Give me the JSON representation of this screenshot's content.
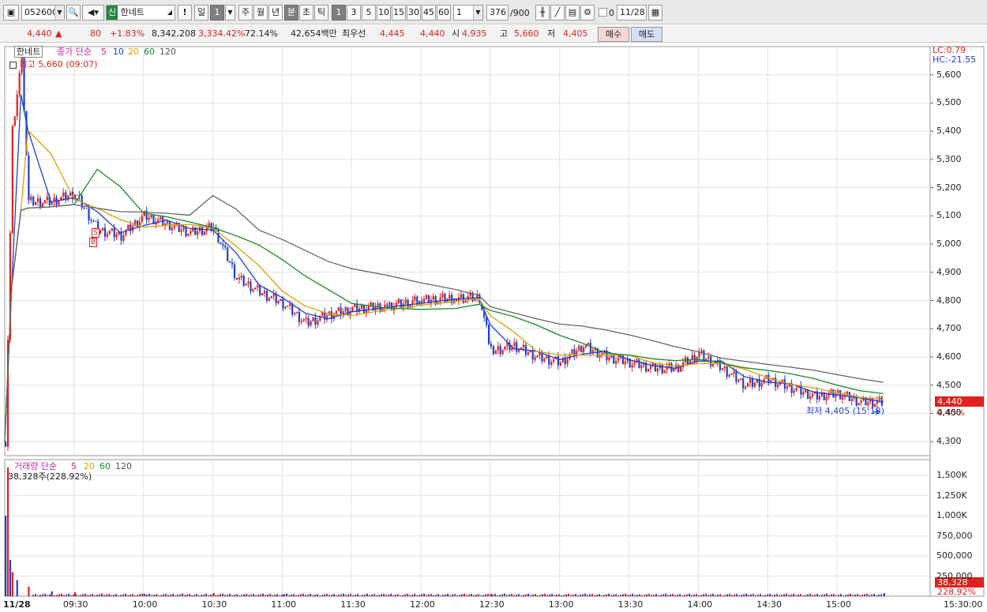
{
  "toolbar": {
    "code": "052600",
    "credit_badge": "신",
    "stock_name": "한네트",
    "alert_label": "!",
    "period_day": "일",
    "period_num": "1",
    "period_week": "주",
    "period_month": "월",
    "period_year": "년",
    "period_minute": "분",
    "period_second": "초",
    "period_tick": "틱",
    "intervals": [
      "1",
      "3",
      "5",
      "10",
      "15",
      "30",
      "45",
      "60"
    ],
    "interval_value": "1",
    "count_value": "376",
    "count_total": "/900",
    "checkbox_label": "0",
    "date_value": "11/28"
  },
  "quote": {
    "price": "4,440",
    "change_arrow": "▲",
    "change": "80",
    "change_pct": "+1.83%",
    "volume": "8,342,208",
    "volume_ratio": "3,334.42%",
    "turnover_ratio": "72.14%",
    "amount": "42,654백만",
    "best_label": "최우선",
    "best_ask": "4,445",
    "best_bid": "4,440",
    "open_label": "시",
    "open": "4,935",
    "high_label": "고",
    "high": "5,660",
    "low_label": "저",
    "low": "4,405",
    "buy_label": "매수",
    "sell_label": "매도"
  },
  "price_panel": {
    "name_tag": "한네트",
    "legend_label": "종가 단순",
    "ma": [
      "5",
      "10",
      "20",
      "60",
      "120"
    ],
    "high_marker": "최고 5,660 (09:07)",
    "low_marker": "최저 4,405 (15:18)",
    "lc": "LC:0.79",
    "hc": "HC:-21.55",
    "current_price": "4,440",
    "current_pct": "0.45%",
    "signal_s": "S",
    "signal_b": "B"
  },
  "volume_panel": {
    "legend_label": "거래량 단순",
    "ma": [
      "5",
      "20",
      "60",
      "120"
    ],
    "info": "38,328주(228.92%)",
    "current_volume": "38,328",
    "current_pct": "228.92%"
  },
  "chart_data": [
    {
      "type": "candlestick",
      "title": "한네트",
      "y_ticks": [
        "5,600",
        "5,500",
        "5,400",
        "5,300",
        "5,200",
        "5,100",
        "5,000",
        "4,900",
        "4,800",
        "4,700",
        "4,600",
        "4,500",
        "4,400",
        "4,300"
      ],
      "ylim": [
        4250,
        5700
      ],
      "x_ticks": [
        "11/28",
        "09:30",
        "10:00",
        "10:30",
        "11:00",
        "11:30",
        "12:00",
        "12:30",
        "13:00",
        "13:30",
        "14:00",
        "14:30",
        "15:00",
        "15:30:00"
      ],
      "series": [
        {
          "name": "종가",
          "x": [
            "09:00",
            "09:03",
            "09:07",
            "09:10",
            "09:20",
            "09:30",
            "09:40",
            "09:50",
            "10:00",
            "10:10",
            "10:20",
            "10:30",
            "10:40",
            "10:50",
            "11:00",
            "11:10",
            "11:20",
            "11:30",
            "11:45",
            "12:00",
            "12:15",
            "12:25",
            "12:30",
            "12:40",
            "12:50",
            "13:00",
            "13:10",
            "13:20",
            "13:30",
            "13:40",
            "13:50",
            "14:00",
            "14:10",
            "14:20",
            "14:30",
            "14:40",
            "14:50",
            "15:00",
            "15:10",
            "15:20"
          ],
          "values": [
            4300,
            5400,
            5660,
            5150,
            5150,
            5180,
            5050,
            5030,
            5100,
            5070,
            5040,
            5060,
            4880,
            4830,
            4790,
            4720,
            4750,
            4770,
            4780,
            4800,
            4810,
            4810,
            4620,
            4640,
            4600,
            4580,
            4640,
            4600,
            4580,
            4560,
            4560,
            4610,
            4560,
            4500,
            4520,
            4490,
            4460,
            4470,
            4440,
            4440
          ]
        }
      ],
      "grid": true
    },
    {
      "type": "bar",
      "title": "거래량",
      "y_ticks": [
        "1,500K",
        "1,250K",
        "1,000K",
        "750,000",
        "500,000",
        "250,000"
      ],
      "ylim": [
        0,
        1600000
      ],
      "series": [
        {
          "name": "거래량",
          "x": [
            "09:00",
            "09:01",
            "09:02",
            "09:03",
            "09:05",
            "09:10",
            "09:20",
            "09:30",
            "10:00",
            "10:30",
            "11:00",
            "12:30",
            "15:20"
          ],
          "values": [
            1000000,
            1600000,
            450000,
            300000,
            200000,
            120000,
            60000,
            50000,
            30000,
            40000,
            20000,
            30000,
            38328
          ]
        }
      ]
    }
  ]
}
